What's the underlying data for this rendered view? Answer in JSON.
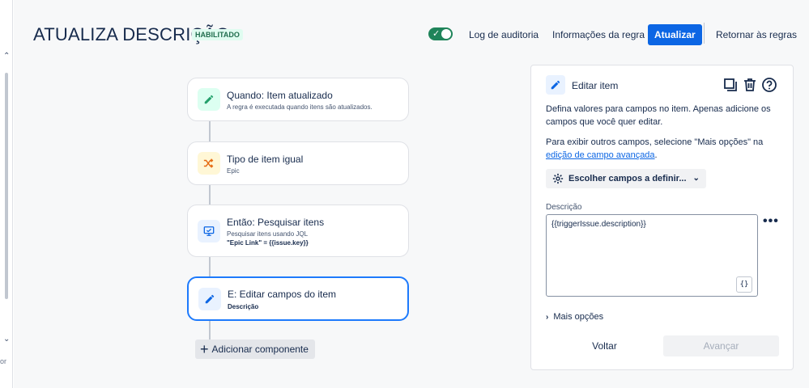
{
  "sidebar": {
    "scroll_up": "⌃",
    "scroll_down": "⌄",
    "cut_text": "or"
  },
  "header": {
    "title": "ATUALIZA DESCRIÇÃO",
    "status_badge": "HABILITADO",
    "toggle_on": true,
    "audit_log": "Log de auditoria",
    "rule_info": "Informações da regra",
    "update": "Atualizar",
    "back_to_rules": "Retornar às regras"
  },
  "flow": {
    "components": [
      {
        "title": "Quando: Item atualizado",
        "subtitle": "A regra é executada quando itens são atualizados.",
        "icon": "pencil-icon",
        "color": "#22a06b"
      },
      {
        "title": "Tipo de item igual",
        "subtitle": "Epic",
        "icon": "shuffle-icon",
        "color": "#e56910"
      },
      {
        "title": "Então: Pesquisar itens",
        "subtitle": "Pesquisar itens usando JQL",
        "subtitle2": "\"Epic Link\" = {{issue.key}}",
        "icon": "monitor-icon",
        "color": "#0c66e4"
      },
      {
        "title": "E: Editar campos do item",
        "subtitle": "Descrição",
        "icon": "pencil-icon",
        "color": "#0c66e4"
      }
    ],
    "add_component": "Adicionar componente"
  },
  "panel": {
    "title": "Editar item",
    "desc": "Defina valores para campos no item. Apenas adicione os campos que você quer editar.",
    "desc2_prefix": "Para exibir outros campos, selecione \"Mais opções\" na ",
    "desc2_link": "edição de campo avançada",
    "desc2_suffix": ".",
    "choose_fields": "Escolher campos a definir...",
    "field_label": "Descrição",
    "field_value": "{{triggerIssue.description}}",
    "brace_button": "{}",
    "more_menu": "•••",
    "more_options": "Mais opções",
    "back": "Voltar",
    "next": "Avançar"
  }
}
